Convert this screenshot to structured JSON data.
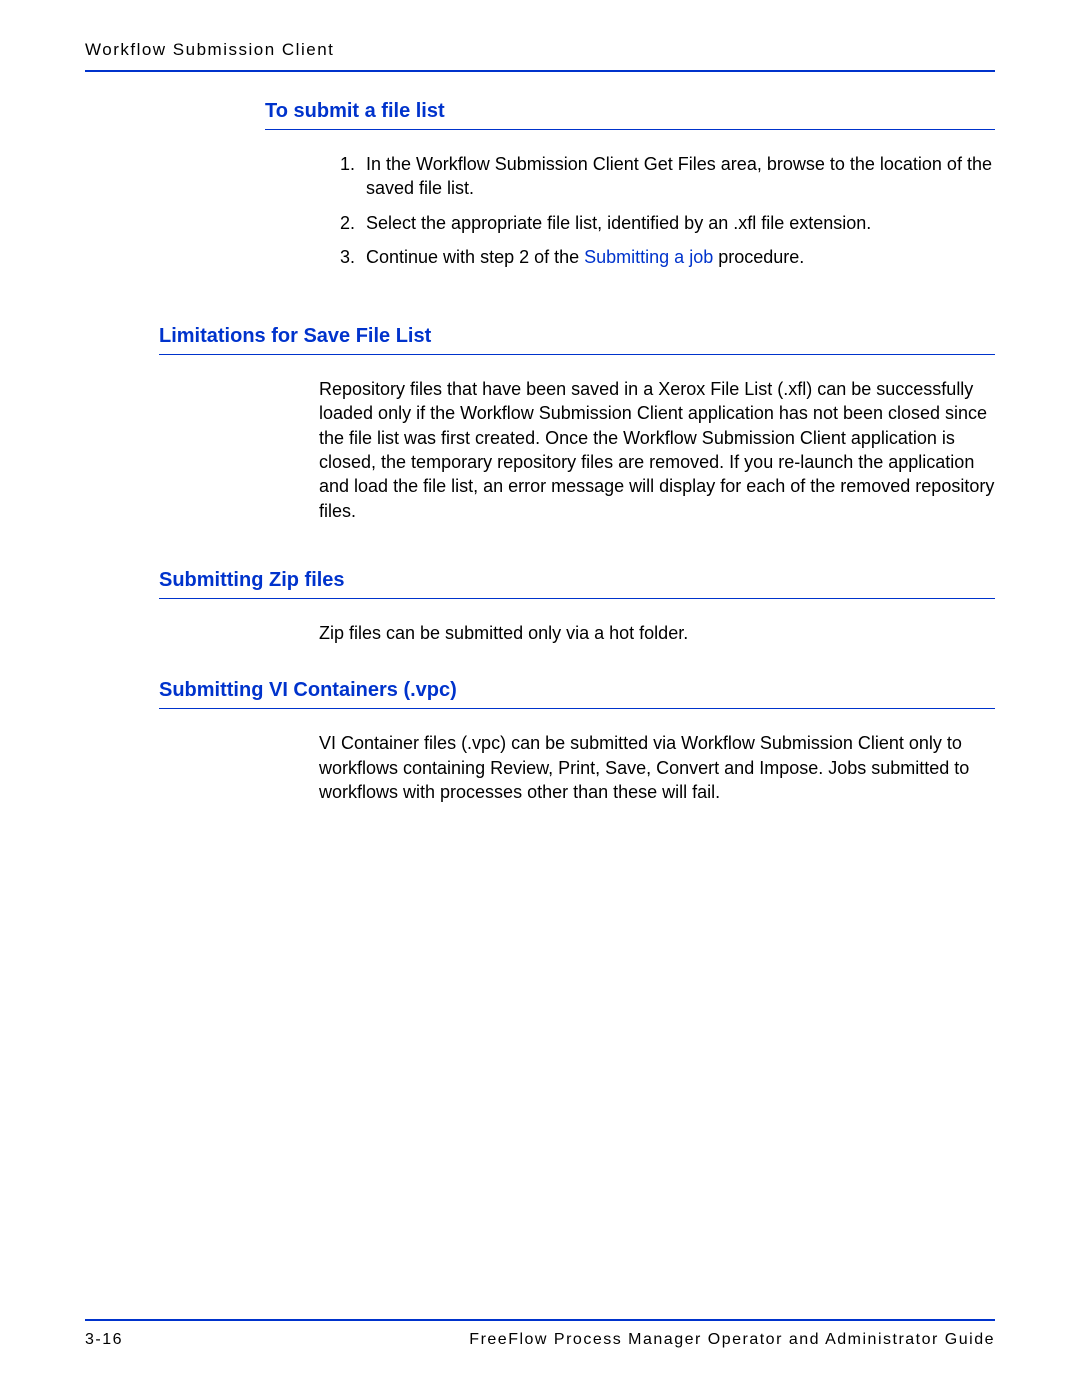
{
  "header": {
    "title": "Workflow Submission Client"
  },
  "sections": {
    "submit_file_list": {
      "heading": "To submit a file list",
      "items": [
        {
          "num": "1.",
          "text": "In the Workflow Submission Client Get Files area, browse to the location of the saved file list."
        },
        {
          "num": "2.",
          "text": "Select the appropriate file list, identified by an .xfl file extension."
        },
        {
          "num": "3.",
          "text_before": "Continue with step 2 of the ",
          "link_text": "Submitting a job",
          "text_after": " procedure."
        }
      ]
    },
    "limitations": {
      "heading": "Limitations for Save File List",
      "body": "Repository files that have been saved in a Xerox File List (.xfl) can be successfully loaded only if the Workflow Submission Client application has not been closed since the file list was first created. Once the Workflow Submission Client application is closed, the temporary repository files are removed. If you re-launch the application and load the file list, an error message will display for each of the removed repository files."
    },
    "zip": {
      "heading": "Submitting Zip files",
      "body": "Zip files can be submitted only via a hot folder."
    },
    "vi": {
      "heading": "Submitting VI Containers (.vpc)",
      "body": "VI Container files (.vpc) can be submitted via Workflow Submission Client only to workflows containing Review, Print, Save, Convert and Impose. Jobs submitted to workflows with processes other than these will fail."
    }
  },
  "footer": {
    "page_number": "3-16",
    "book_title": "FreeFlow Process Manager Operator and Administrator Guide"
  }
}
